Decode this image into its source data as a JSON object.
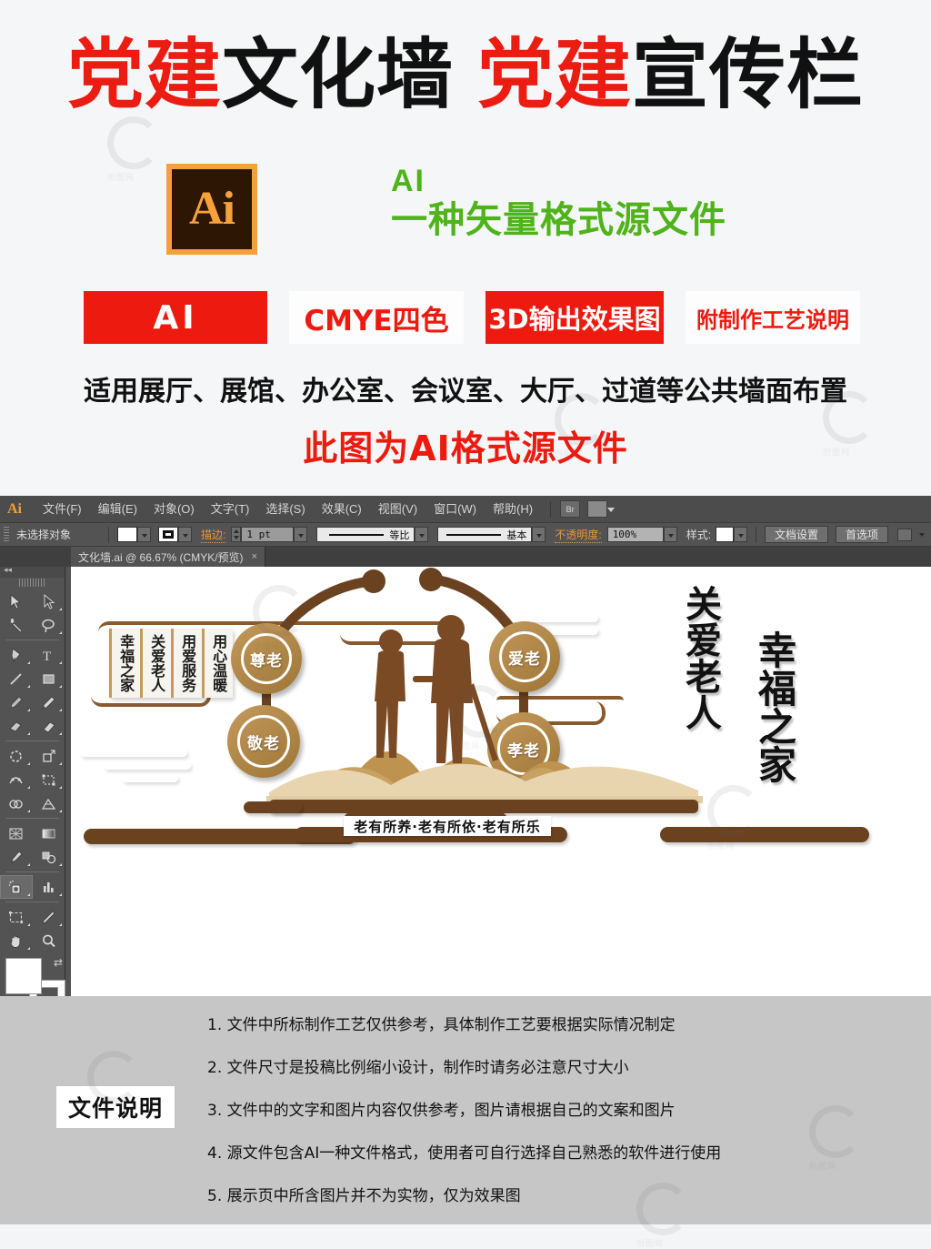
{
  "promo": {
    "title_parts": [
      {
        "text": "党建",
        "color": "red"
      },
      {
        "text": "文化墙",
        "color": "black"
      },
      {
        "text": "党建",
        "color": "red"
      },
      {
        "text": "宣传栏",
        "color": "black"
      }
    ],
    "ai_badge_glyph": "Ai",
    "vector_note_ai": "AI",
    "vector_note_cn": "一种矢量格式源文件",
    "badges": [
      {
        "label": "AI",
        "style": "solid"
      },
      {
        "label": "CMYE四色",
        "style": "hollow"
      },
      {
        "label": "3D输出效果图",
        "style": "solid"
      },
      {
        "label": "附制作工艺说明",
        "style": "hollow"
      }
    ],
    "scope_line": "适用展厅、展馆、办公室、会议室、大厅、过道等公共墙面布置",
    "source_line": "此图为AI格式源文件",
    "colors": {
      "red": "#ed1b0f",
      "green": "#4fb31a",
      "ai_orange": "#f5a03c",
      "ai_dark": "#2d1604"
    },
    "watermark_text": "创图网"
  },
  "app": {
    "logo": "Ai",
    "menus": [
      {
        "label": "文件(F)"
      },
      {
        "label": "编辑(E)"
      },
      {
        "label": "对象(O)"
      },
      {
        "label": "文字(T)"
      },
      {
        "label": "选择(S)"
      },
      {
        "label": "效果(C)"
      },
      {
        "label": "视图(V)"
      },
      {
        "label": "窗口(W)"
      },
      {
        "label": "帮助(H)"
      }
    ],
    "bridge_button": "Br",
    "control_bar": {
      "selection_status": "未选择对象",
      "stroke_label": "描边:",
      "stroke_weight": "1 pt",
      "profile_uniform": "等比",
      "brush_basic": "基本",
      "opacity_label": "不透明度:",
      "opacity_value": "100%",
      "style_label": "样式:",
      "doc_setup_button": "文档设置",
      "preferences_button": "首选项"
    },
    "document_tab": {
      "title": "文化墙.ai @ 66.67% (CMYK/预览)",
      "close": "×"
    },
    "tools": [
      "selection-tool",
      "direct-selection-tool",
      "magic-wand-tool",
      "lasso-tool",
      "pen-tool",
      "type-tool",
      "line-segment-tool",
      "rectangle-tool",
      "paintbrush-tool",
      "pencil-tool",
      "blob-brush-tool",
      "eraser-tool",
      "rotate-tool",
      "scale-tool",
      "width-tool",
      "free-transform-tool",
      "shape-builder-tool",
      "perspective-grid-tool",
      "mesh-tool",
      "gradient-tool",
      "eyedropper-tool",
      "blend-tool",
      "symbol-sprayer-tool",
      "column-graph-tool",
      "artboard-tool",
      "slice-tool",
      "hand-tool",
      "zoom-tool"
    ],
    "selected_tool": "symbol-sprayer-tool",
    "fill_color": "#ffffff",
    "stroke_color": "#000000",
    "paint_modes": [
      "color-mode",
      "gradient-mode",
      "none-mode"
    ],
    "draw_modes": [
      "draw-normal",
      "draw-behind",
      "draw-inside"
    ]
  },
  "artwork": {
    "main_title_right": "关爱老人",
    "main_title_left": "幸福之家",
    "vertical_panel_columns": [
      "用心温暖",
      "用爱服务",
      "关爱老人",
      "幸福之家"
    ],
    "circles": [
      {
        "label": "尊老"
      },
      {
        "label": "敬老"
      },
      {
        "label": "爱老"
      },
      {
        "label": "孝老"
      }
    ],
    "banner_text": "老有所养·老有所依·老有所乐",
    "colors": {
      "dark_brown": "#6b4220",
      "mid_brown": "#8a5a2e",
      "gold": "#c49a5c",
      "sand": "#e8d5b0",
      "figure": "#7a4a24"
    }
  },
  "footer": {
    "tag": "文件说明",
    "notes": [
      "1. 文件中所标制作工艺仅供参考，具体制作工艺要根据实际情况制定",
      "2. 文件尺寸是投稿比例缩小设计，制作时请务必注意尺寸大小",
      "3. 文件中的文字和图片内容仅供参考，图片请根据自己的文案和图片",
      "4. 源文件包含AI一种文件格式，使用者可自行选择自己熟悉的软件进行使用",
      "5. 展示页中所含图片并不为实物，仅为效果图"
    ],
    "background": "#c6c6c6"
  }
}
